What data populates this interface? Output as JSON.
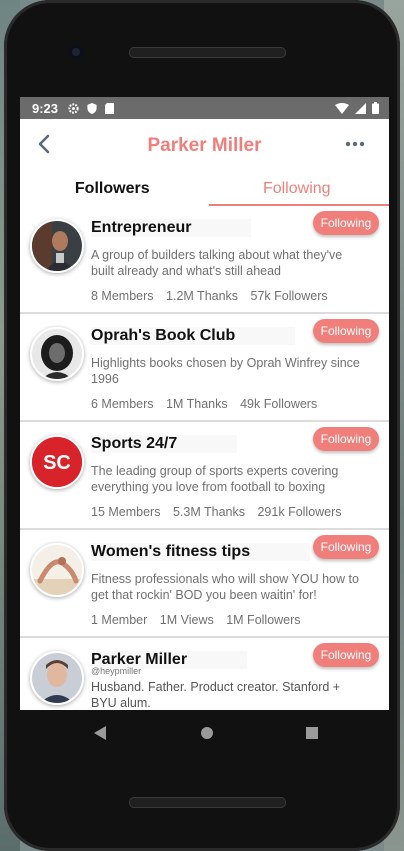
{
  "status_bar": {
    "time": "9:23"
  },
  "header": {
    "title": "Parker Miller"
  },
  "tabs": [
    {
      "label": "Followers"
    },
    {
      "label": "Following"
    }
  ],
  "colors": {
    "accent": "#f07f7c",
    "status_bar": "#6b6b6b"
  },
  "cards": [
    {
      "title": "Entrepreneur",
      "description": "A group of builders talking about what they've built already and what's still ahead",
      "stats": [
        "8 Members",
        "1.2M Thanks",
        "57k Followers"
      ],
      "button": "Following"
    },
    {
      "title": "Oprah's Book Club",
      "description": "Highlights books chosen by Oprah Winfrey since 1996",
      "stats": [
        "6 Members",
        "1M Thanks",
        "49k Followers"
      ],
      "button": "Following"
    },
    {
      "title": "Sports 24/7",
      "description": "The leading group of sports experts covering everything you love from football to boxing",
      "stats": [
        "15 Members",
        "5.3M Thanks",
        "291k Followers"
      ],
      "button": "Following",
      "logo_text": "SC"
    },
    {
      "title": "Women's fitness tips",
      "description": "Fitness professionals who will show YOU how to get that rockin' BOD you been waitin' for!",
      "stats": [
        "1 Member",
        "1M Views",
        "1M Followers"
      ],
      "button": "Following"
    },
    {
      "title": "Parker Miller",
      "handle": "@heypmiller",
      "description": "Husband. Father. Product creator. Stanford + BYU alum.",
      "button": "Following"
    }
  ]
}
